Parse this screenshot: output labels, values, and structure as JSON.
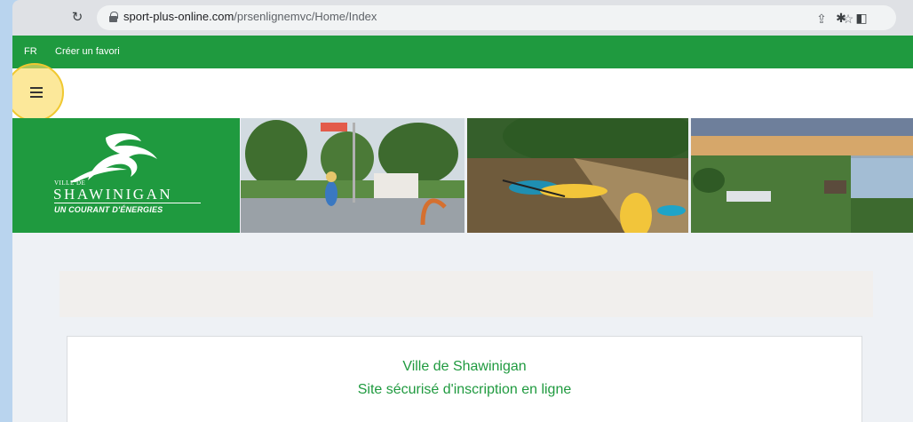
{
  "browser": {
    "url_host": "sport-plus-online.com",
    "url_path": "/prsenlignemvc/Home/Index",
    "reload_icon": "reload-icon",
    "icons": [
      "share-icon",
      "star-icon",
      "extensions-icon",
      "sidepanel-icon"
    ]
  },
  "topbar": {
    "language": "FR",
    "favorite_link": "Créer un favori"
  },
  "logo": {
    "small": "VILLE DE",
    "main": "SHAWINIGAN",
    "tagline": "UN COURANT D'ÉNERGIES"
  },
  "card": {
    "title": "Ville de Shawinigan",
    "subtitle": "Site sécurisé d'inscription en ligne"
  },
  "colors": {
    "brand_green": "#1f9a3f",
    "page_bg": "#eef1f5",
    "highlight": "#fadc64"
  }
}
